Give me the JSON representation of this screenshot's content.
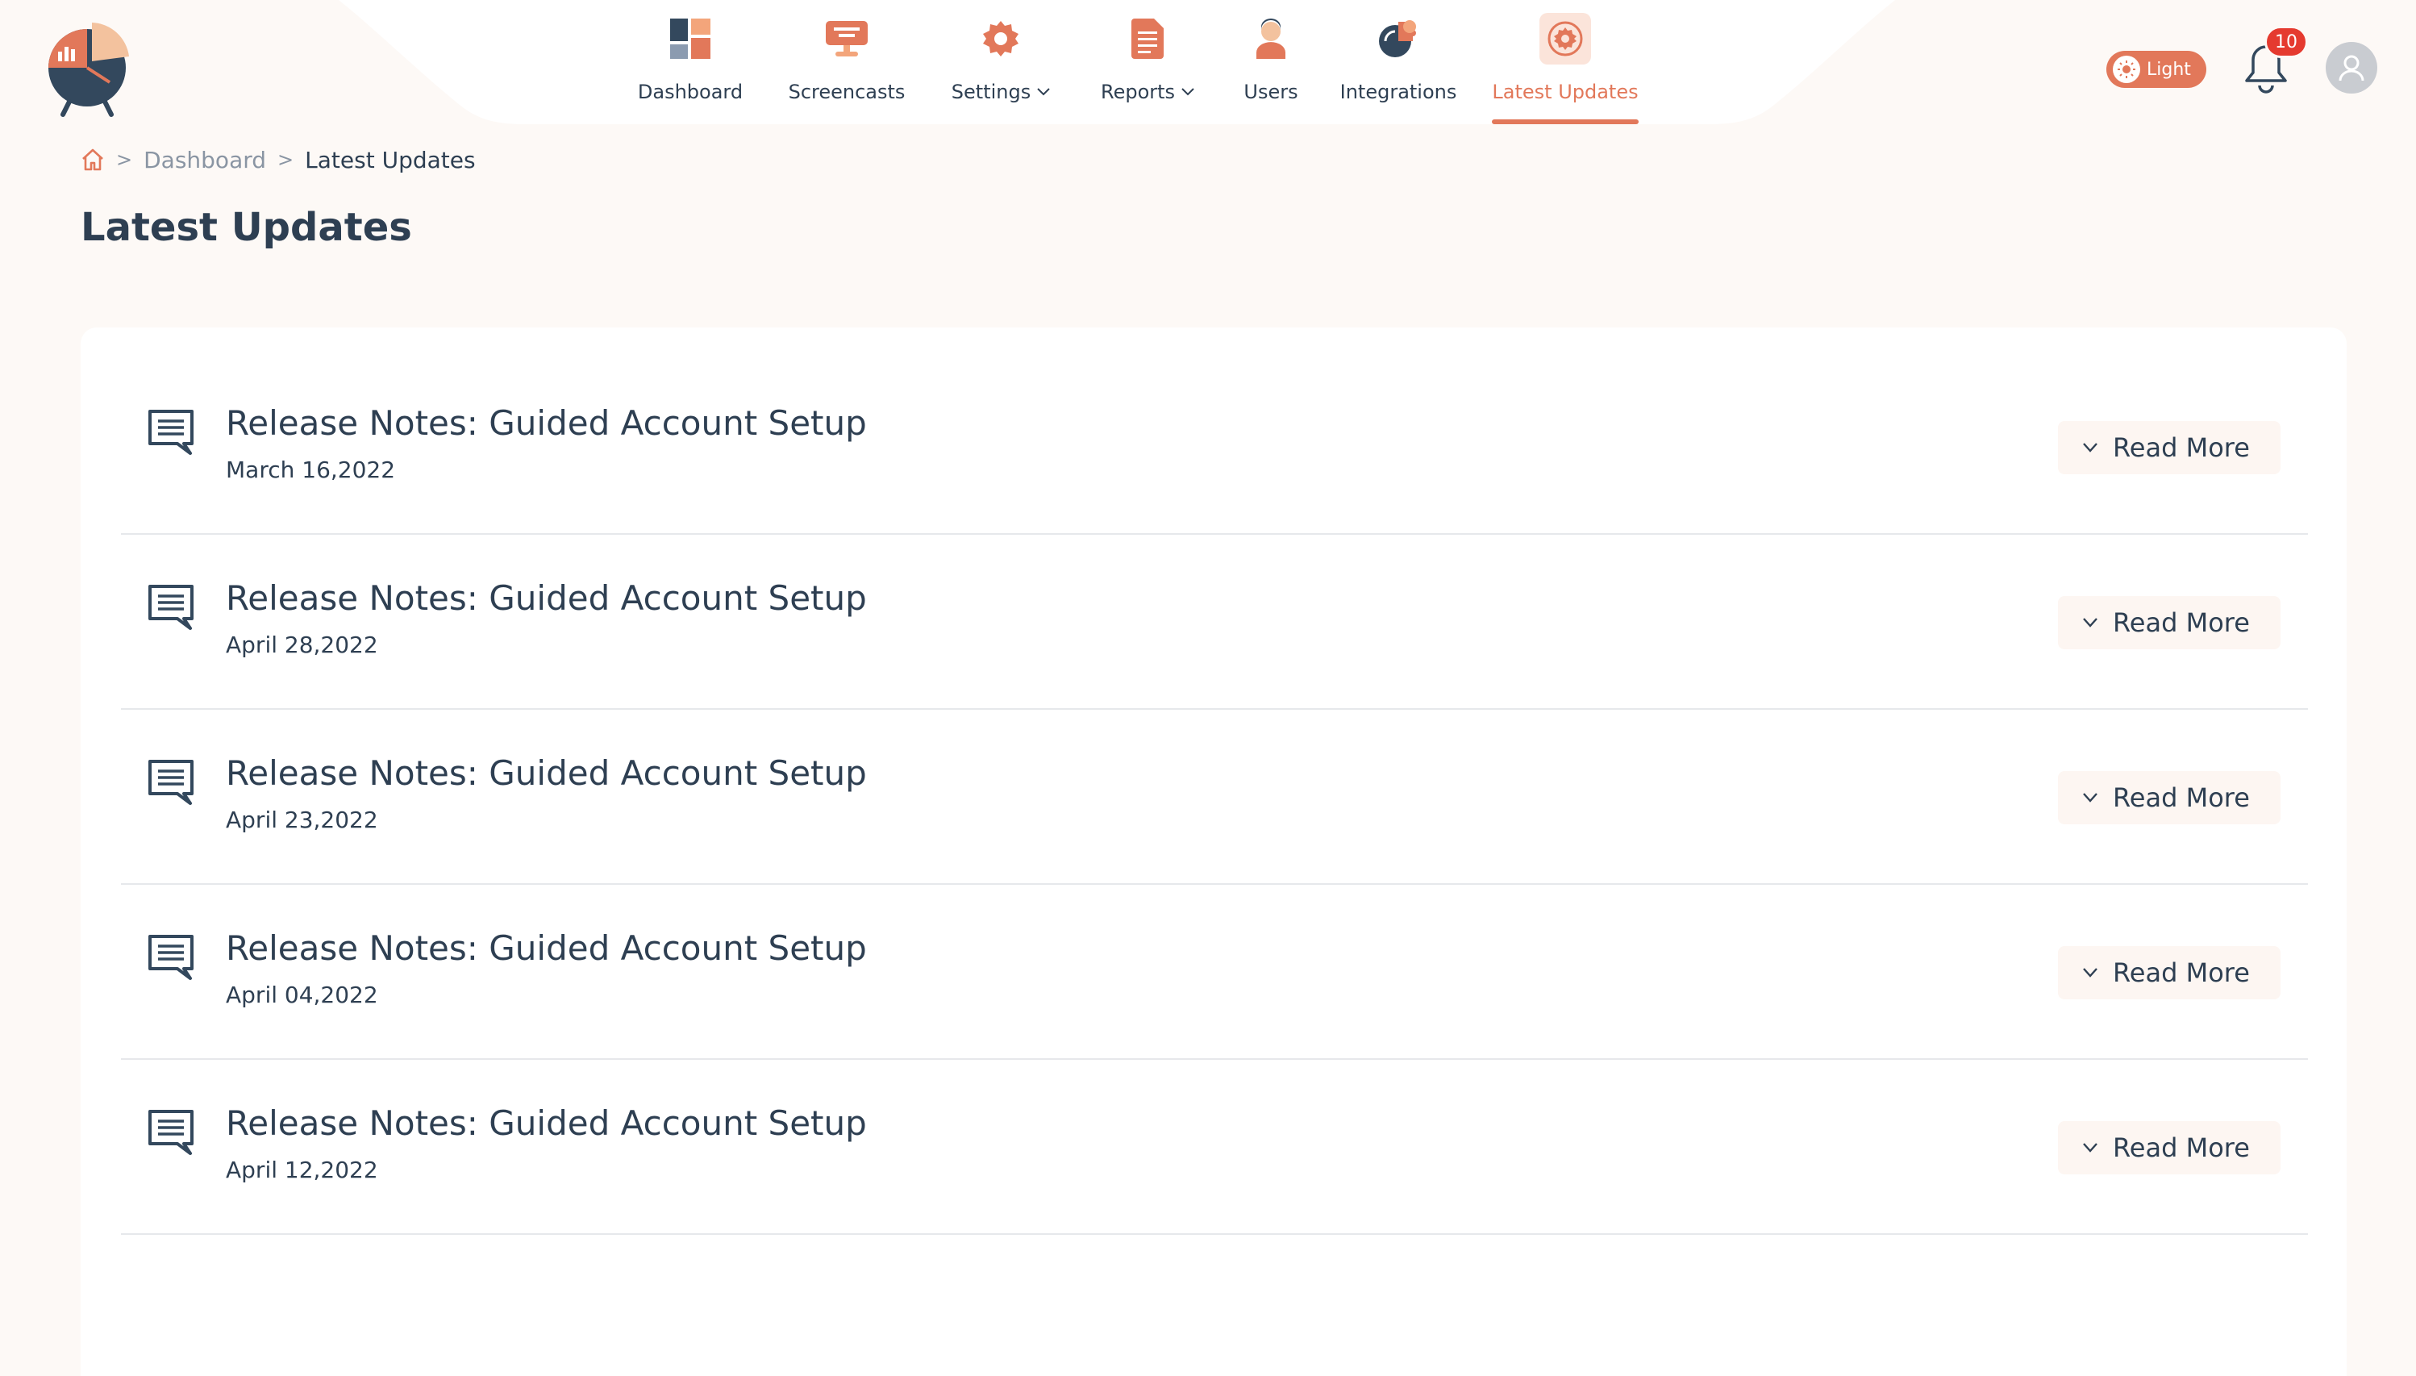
{
  "nav": {
    "items": [
      {
        "label": "Dashboard",
        "icon": "dashboard-icon",
        "dropdown": false,
        "active": false
      },
      {
        "label": "Screencasts",
        "icon": "screencasts-icon",
        "dropdown": false,
        "active": false
      },
      {
        "label": "Settings",
        "icon": "settings-icon",
        "dropdown": true,
        "active": false
      },
      {
        "label": "Reports",
        "icon": "reports-icon",
        "dropdown": true,
        "active": false
      },
      {
        "label": "Users",
        "icon": "users-icon",
        "dropdown": false,
        "active": false
      },
      {
        "label": "Integrations",
        "icon": "integrations-icon",
        "dropdown": false,
        "active": false
      },
      {
        "label": "Latest Updates",
        "icon": "latest-updates-icon",
        "dropdown": false,
        "active": true
      }
    ]
  },
  "header": {
    "theme_label": "Light",
    "notification_count": "10"
  },
  "breadcrumb": {
    "home_icon": "home-icon",
    "items": [
      "Dashboard",
      "Latest Updates"
    ]
  },
  "page": {
    "title": "Latest Updates"
  },
  "updates": {
    "read_more_label": "Read More",
    "items": [
      {
        "title": "Release Notes: Guided Account Setup",
        "date": "March 16,2022"
      },
      {
        "title": "Release Notes: Guided Account Setup",
        "date": "April 28,2022"
      },
      {
        "title": "Release Notes: Guided Account Setup",
        "date": "April 23,2022"
      },
      {
        "title": "Release Notes: Guided Account Setup",
        "date": "April 04,2022"
      },
      {
        "title": "Release Notes: Guided Account Setup",
        "date": "April 12,2022"
      }
    ]
  },
  "colors": {
    "accent": "#e2785a",
    "text": "#2e3f52",
    "muted": "#8a95a3",
    "background": "#fdf9f6",
    "badge": "#e53a2f"
  }
}
